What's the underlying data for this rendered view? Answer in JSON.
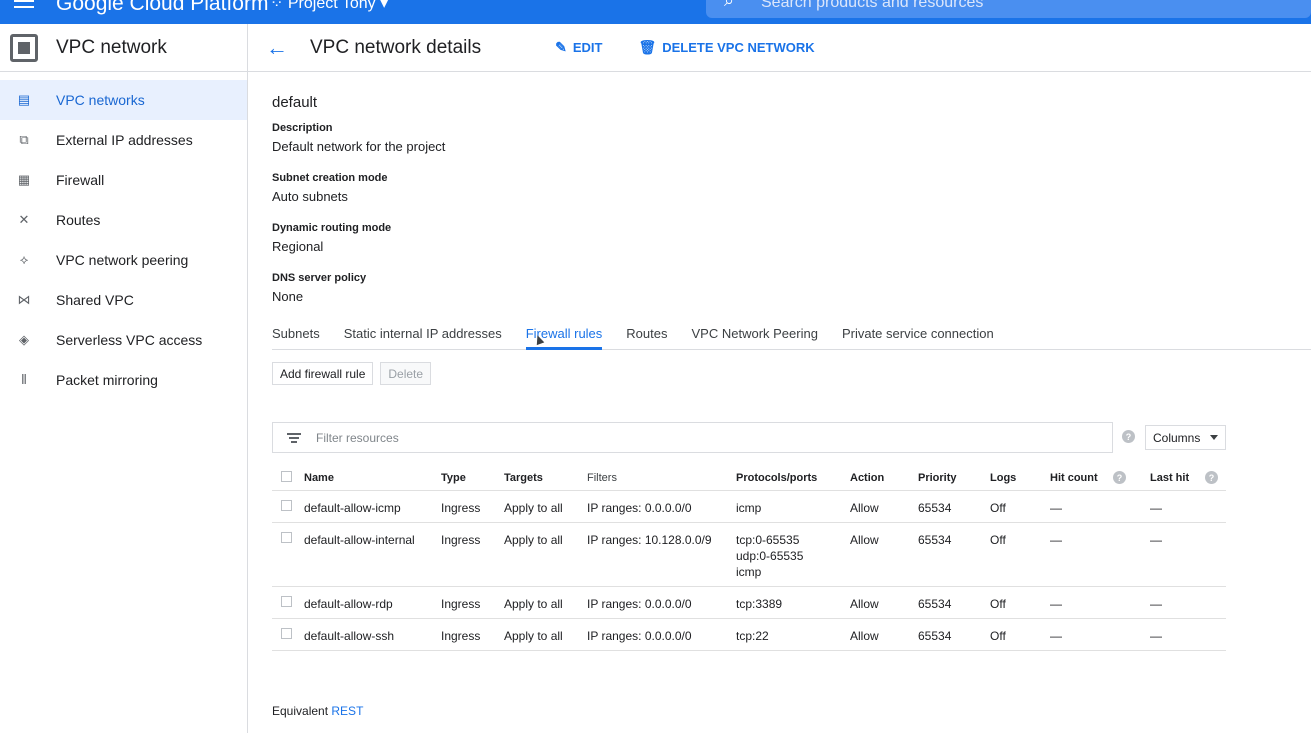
{
  "topbar": {
    "brand": "Google Cloud Platform",
    "project": "Project Tony",
    "search_placeholder": "Search products and resources",
    "color": "#1a73e8"
  },
  "sidebar": {
    "product_title": "VPC network",
    "items": [
      {
        "label": "VPC networks",
        "icon": "vpc-networks-icon",
        "active": true
      },
      {
        "label": "External IP addresses",
        "icon": "external-ip-icon",
        "active": false
      },
      {
        "label": "Firewall",
        "icon": "firewall-icon",
        "active": false
      },
      {
        "label": "Routes",
        "icon": "routes-icon",
        "active": false
      },
      {
        "label": "VPC network peering",
        "icon": "peering-icon",
        "active": false
      },
      {
        "label": "Shared VPC",
        "icon": "shared-vpc-icon",
        "active": false
      },
      {
        "label": "Serverless VPC access",
        "icon": "serverless-icon",
        "active": false
      },
      {
        "label": "Packet mirroring",
        "icon": "packet-mirroring-icon",
        "active": false
      }
    ]
  },
  "header": {
    "title": "VPC network details",
    "edit_label": "EDIT",
    "delete_label": "DELETE VPC NETWORK"
  },
  "network": {
    "name": "default",
    "fields": [
      {
        "label": "Description",
        "value": "Default network for the project"
      },
      {
        "label": "Subnet creation mode",
        "value": "Auto subnets"
      },
      {
        "label": "Dynamic routing mode",
        "value": "Regional"
      },
      {
        "label": "DNS server policy",
        "value": "None"
      }
    ]
  },
  "tabs": [
    {
      "label": "Subnets",
      "active": false
    },
    {
      "label": "Static internal IP addresses",
      "active": false
    },
    {
      "label": "Firewall rules",
      "active": true
    },
    {
      "label": "Routes",
      "active": false
    },
    {
      "label": "VPC Network Peering",
      "active": false
    },
    {
      "label": "Private service connection",
      "active": false
    }
  ],
  "actions": {
    "add_label": "Add firewall rule",
    "delete_label": "Delete"
  },
  "filter": {
    "placeholder": "Filter resources",
    "columns_label": "Columns",
    "help": "?"
  },
  "table": {
    "headers": {
      "name": "Name",
      "type": "Type",
      "targets": "Targets",
      "filters": "Filters",
      "protocols": "Protocols/ports",
      "action": "Action",
      "priority": "Priority",
      "logs": "Logs",
      "hit_count": "Hit count",
      "last_hit": "Last hit"
    },
    "rows": [
      {
        "name": "default-allow-icmp",
        "type": "Ingress",
        "targets": "Apply to all",
        "filters": "IP ranges: 0.0.0.0/0",
        "protocols": [
          "icmp"
        ],
        "action": "Allow",
        "priority": "65534",
        "logs": "Off",
        "hit_count": "—",
        "last_hit": "—"
      },
      {
        "name": "default-allow-internal",
        "type": "Ingress",
        "targets": "Apply to all",
        "filters": "IP ranges: 10.128.0.0/9",
        "protocols": [
          "tcp:0-65535",
          "udp:0-65535",
          "icmp"
        ],
        "action": "Allow",
        "priority": "65534",
        "logs": "Off",
        "hit_count": "—",
        "last_hit": "—"
      },
      {
        "name": "default-allow-rdp",
        "type": "Ingress",
        "targets": "Apply to all",
        "filters": "IP ranges: 0.0.0.0/0",
        "protocols": [
          "tcp:3389"
        ],
        "action": "Allow",
        "priority": "65534",
        "logs": "Off",
        "hit_count": "—",
        "last_hit": "—"
      },
      {
        "name": "default-allow-ssh",
        "type": "Ingress",
        "targets": "Apply to all",
        "filters": "IP ranges: 0.0.0.0/0",
        "protocols": [
          "tcp:22"
        ],
        "action": "Allow",
        "priority": "65534",
        "logs": "Off",
        "hit_count": "—",
        "last_hit": "—"
      }
    ]
  },
  "footer": {
    "prefix": "Equivalent",
    "link": "REST"
  }
}
